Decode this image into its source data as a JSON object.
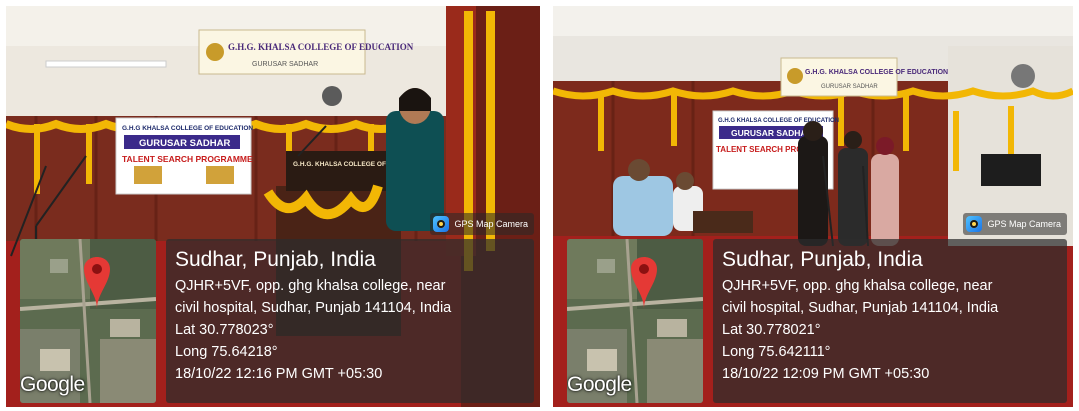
{
  "photos": [
    {
      "badge": "GPS Map Camera",
      "watermark": "Google",
      "location": "Sudhar, Punjab, India",
      "address_line1": "QJHR+5VF, opp. ghg khalsa college, near",
      "address_line2": "civil hospital, Sudhar, Punjab 141104, India",
      "lat": "Lat 30.778023°",
      "long": "Long 75.64218°",
      "datetime": "18/10/22 12:16 PM GMT +05:30",
      "banner_top": "G.H.G. KHALSA COLLEGE OF EDUCATION",
      "banner_top_sub": "GURUSAR SADHAR",
      "banner_main_1": "G.H.G KHALSA COLLEGE OF EDUCATION",
      "banner_main_2": "GURUSAR SADHAR",
      "banner_main_3": "TALENT SEARCH PROGRAMME",
      "podium": "G.H.G. KHALSA COLLEGE OF EDUCATION"
    },
    {
      "badge": "GPS Map Camera",
      "watermark": "Google",
      "location": "Sudhar, Punjab, India",
      "address_line1": "QJHR+5VF, opp. ghg khalsa college, near",
      "address_line2": "civil hospital, Sudhar, Punjab 141104, India",
      "lat": "Lat 30.778021°",
      "long": "Long 75.642111°",
      "datetime": "18/10/22 12:09 PM GMT +05:30",
      "banner_top": "G.H.G. KHALSA COLLEGE OF EDUCATION",
      "banner_top_sub": "GURUSAR SADHAR",
      "banner_main_1": "G.H.G KHALSA COLLEGE OF EDUCATION",
      "banner_main_2": "GURUSAR SADHAR",
      "banner_main_3": "TALENT SEARCH PRO"
    }
  ],
  "colors": {
    "wall": "#ede8df",
    "curtain": "#8a2a1c",
    "marigold": "#f2b705",
    "stage_red": "#a3201c",
    "overlay": "#2d2d2d",
    "pin": "#e53935"
  }
}
